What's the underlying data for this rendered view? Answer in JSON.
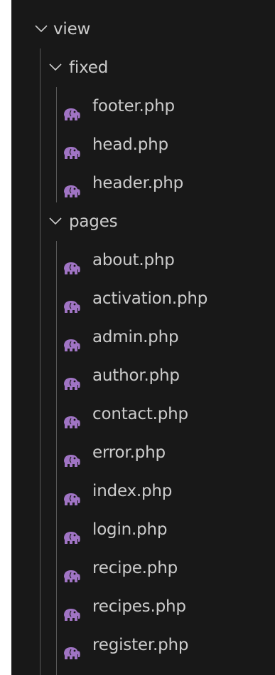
{
  "tree": {
    "folder_view": "view",
    "folder_fixed": "fixed",
    "fixed_files": [
      "footer.php",
      "head.php",
      "header.php"
    ],
    "folder_pages": "pages",
    "pages_files": [
      "about.php",
      "activation.php",
      "admin.php",
      "author.php",
      "contact.php",
      "error.php",
      "index.php",
      "login.php",
      "recipe.php",
      "recipes.php",
      "register.php"
    ]
  },
  "colors": {
    "panel_bg": "#181818",
    "text": "#cccccc",
    "php_icon": "#a074c4",
    "guide_line": "#585858"
  },
  "icons": {
    "folder_expanded": "chevron-down-icon",
    "php_file": "php-elephant-icon"
  }
}
